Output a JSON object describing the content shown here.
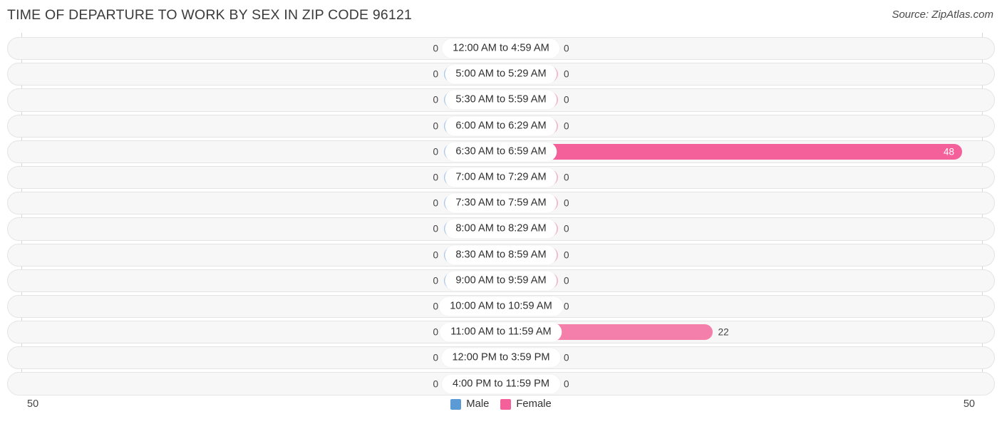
{
  "header": {
    "title": "TIME OF DEPARTURE TO WORK BY SEX IN ZIP CODE 96121",
    "source": "Source: ZipAtlas.com"
  },
  "legend": {
    "items": [
      {
        "label": "Male",
        "color": "#5b9bd5"
      },
      {
        "label": "Female",
        "color": "#f4609a"
      }
    ]
  },
  "axis": {
    "left_tick": "50",
    "right_tick": "50",
    "max": 50
  },
  "colors": {
    "male_bar": "#a8c8ec",
    "female_bar_light": "#f7b2cb",
    "female_bar_mid": "#f57fab",
    "female_bar_strong": "#f4609a",
    "track_bg": "#f7f7f7",
    "track_border": "#e4e4e4",
    "axis_line": "#d6d6d6"
  },
  "chart_data": {
    "type": "bar",
    "title": "TIME OF DEPARTURE TO WORK BY SEX IN ZIP CODE 96121",
    "subtitle": "Source: ZipAtlas.com",
    "orientation": "horizontal-diverging",
    "xlabel": "",
    "ylabel": "",
    "xlim": [
      50,
      50
    ],
    "grid": false,
    "legend_position": "bottom-center",
    "categories": [
      "12:00 AM to 4:59 AM",
      "5:00 AM to 5:29 AM",
      "5:30 AM to 5:59 AM",
      "6:00 AM to 6:29 AM",
      "6:30 AM to 6:59 AM",
      "7:00 AM to 7:29 AM",
      "7:30 AM to 7:59 AM",
      "8:00 AM to 8:29 AM",
      "8:30 AM to 8:59 AM",
      "9:00 AM to 9:59 AM",
      "10:00 AM to 10:59 AM",
      "11:00 AM to 11:59 AM",
      "12:00 PM to 3:59 PM",
      "4:00 PM to 11:59 PM"
    ],
    "series": [
      {
        "name": "Male",
        "color": "#5b9bd5",
        "values": [
          0,
          0,
          0,
          0,
          0,
          0,
          0,
          0,
          0,
          0,
          0,
          0,
          0,
          0
        ]
      },
      {
        "name": "Female",
        "color": "#f4609a",
        "values": [
          0,
          0,
          0,
          0,
          48,
          0,
          0,
          0,
          0,
          0,
          0,
          22,
          0,
          0
        ]
      }
    ]
  },
  "rows": [
    {
      "label": "12:00 AM to 4:59 AM",
      "male": "0",
      "female": "0",
      "male_pct": 0,
      "female_pct": 0,
      "female_shade": "#f7b2cb",
      "female_inside": false
    },
    {
      "label": "5:00 AM to 5:29 AM",
      "male": "0",
      "female": "0",
      "male_pct": 0,
      "female_pct": 0,
      "female_shade": "#f7b2cb",
      "female_inside": false
    },
    {
      "label": "5:30 AM to 5:59 AM",
      "male": "0",
      "female": "0",
      "male_pct": 0,
      "female_pct": 0,
      "female_shade": "#f7b2cb",
      "female_inside": false
    },
    {
      "label": "6:00 AM to 6:29 AM",
      "male": "0",
      "female": "0",
      "male_pct": 0,
      "female_pct": 0,
      "female_shade": "#f7b2cb",
      "female_inside": false
    },
    {
      "label": "6:30 AM to 6:59 AM",
      "male": "0",
      "female": "48",
      "male_pct": 0,
      "female_pct": 96,
      "female_shade": "#f4609a",
      "female_inside": true
    },
    {
      "label": "7:00 AM to 7:29 AM",
      "male": "0",
      "female": "0",
      "male_pct": 0,
      "female_pct": 0,
      "female_shade": "#f7b2cb",
      "female_inside": false
    },
    {
      "label": "7:30 AM to 7:59 AM",
      "male": "0",
      "female": "0",
      "male_pct": 0,
      "female_pct": 0,
      "female_shade": "#f7b2cb",
      "female_inside": false
    },
    {
      "label": "8:00 AM to 8:29 AM",
      "male": "0",
      "female": "0",
      "male_pct": 0,
      "female_pct": 0,
      "female_shade": "#f7b2cb",
      "female_inside": false
    },
    {
      "label": "8:30 AM to 8:59 AM",
      "male": "0",
      "female": "0",
      "male_pct": 0,
      "female_pct": 0,
      "female_shade": "#f7b2cb",
      "female_inside": false
    },
    {
      "label": "9:00 AM to 9:59 AM",
      "male": "0",
      "female": "0",
      "male_pct": 0,
      "female_pct": 0,
      "female_shade": "#f7b2cb",
      "female_inside": false
    },
    {
      "label": "10:00 AM to 10:59 AM",
      "male": "0",
      "female": "0",
      "male_pct": 0,
      "female_pct": 0,
      "female_shade": "#f7b2cb",
      "female_inside": false
    },
    {
      "label": "11:00 AM to 11:59 AM",
      "male": "0",
      "female": "22",
      "male_pct": 0,
      "female_pct": 44,
      "female_shade": "#f57fab",
      "female_inside": false
    },
    {
      "label": "12:00 PM to 3:59 PM",
      "male": "0",
      "female": "0",
      "male_pct": 0,
      "female_pct": 0,
      "female_shade": "#f7b2cb",
      "female_inside": false
    },
    {
      "label": "4:00 PM to 11:59 PM",
      "male": "0",
      "female": "0",
      "male_pct": 0,
      "female_pct": 0,
      "female_shade": "#f7b2cb",
      "female_inside": false
    }
  ]
}
